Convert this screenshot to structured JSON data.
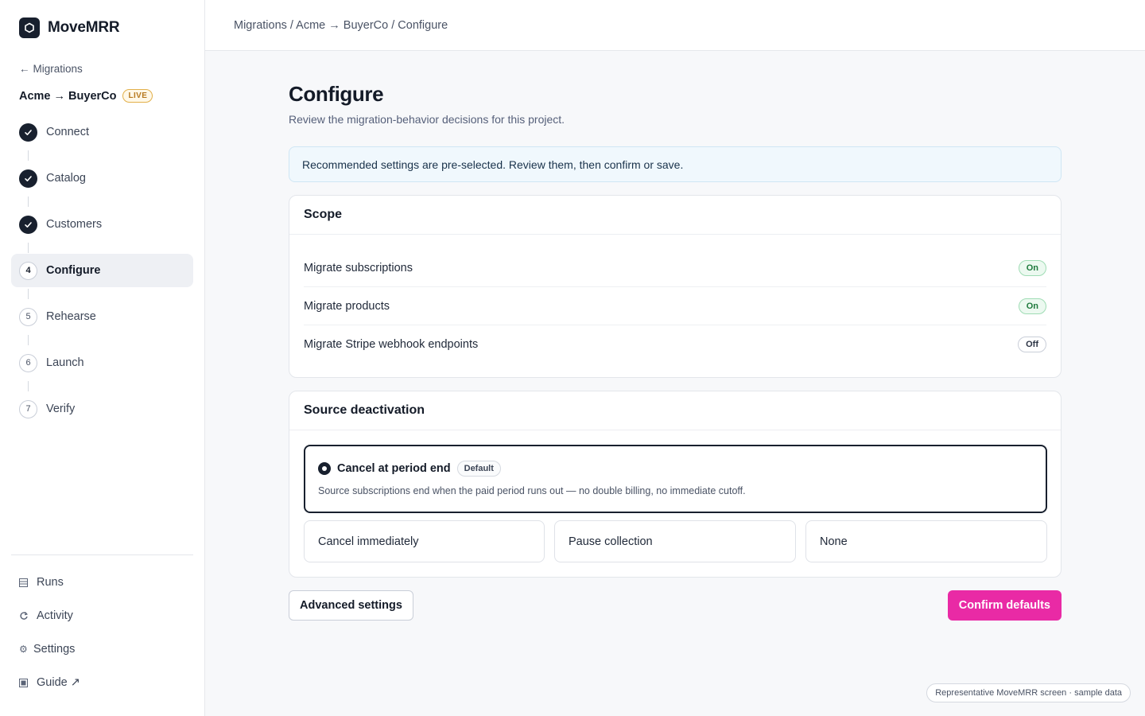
{
  "brand": {
    "name": "MoveMRR",
    "logo_icon": "hexagon-icon"
  },
  "sidebar": {
    "back_label": "Migrations",
    "project": {
      "name": "Acme → BuyerCo",
      "status_badge": "LIVE"
    },
    "steps": [
      {
        "label": "Connect",
        "number": "1",
        "state": "done"
      },
      {
        "label": "Catalog",
        "number": "2",
        "state": "done"
      },
      {
        "label": "Customers",
        "number": "3",
        "state": "done"
      },
      {
        "label": "Configure",
        "number": "4",
        "state": "active"
      },
      {
        "label": "Rehearse",
        "number": "5",
        "state": "pending"
      },
      {
        "label": "Launch",
        "number": "6",
        "state": "pending"
      },
      {
        "label": "Verify",
        "number": "7",
        "state": "pending"
      }
    ],
    "nav": [
      {
        "label": "Runs",
        "icon": "table-icon"
      },
      {
        "label": "Activity",
        "icon": "refresh-icon"
      },
      {
        "label": "Settings",
        "icon": "gear-icon"
      },
      {
        "label": "Guide ↗",
        "icon": "book-icon"
      }
    ]
  },
  "header": {
    "breadcrumb": "Migrations / Acme → BuyerCo / Configure"
  },
  "main": {
    "title": "Configure",
    "subtitle": "Review the migration-behavior decisions for this project.",
    "info_banner": "Recommended settings are pre-selected. Review them, then confirm or save.",
    "scope": {
      "heading": "Scope",
      "rows": [
        {
          "label": "Migrate subscriptions",
          "value": "On"
        },
        {
          "label": "Migrate products",
          "value": "On"
        },
        {
          "label": "Migrate Stripe webhook endpoints",
          "value": "Off"
        }
      ]
    },
    "source_deactivation": {
      "heading": "Source deactivation",
      "selected": {
        "title": "Cancel at period end",
        "badge": "Default",
        "description": "Source subscriptions end when the paid period runs out — no double billing, no immediate cutoff."
      },
      "options": [
        "Cancel immediately",
        "Pause collection",
        "None"
      ]
    },
    "actions": {
      "advanced_label": "Advanced settings",
      "confirm_label": "Confirm defaults"
    }
  },
  "footer_note": "Representative MoveMRR screen · sample data",
  "colors": {
    "accent": "#e92aa5",
    "dark": "#18202e",
    "on_green": "#1f7a3d",
    "live_amber": "#b7791f"
  }
}
